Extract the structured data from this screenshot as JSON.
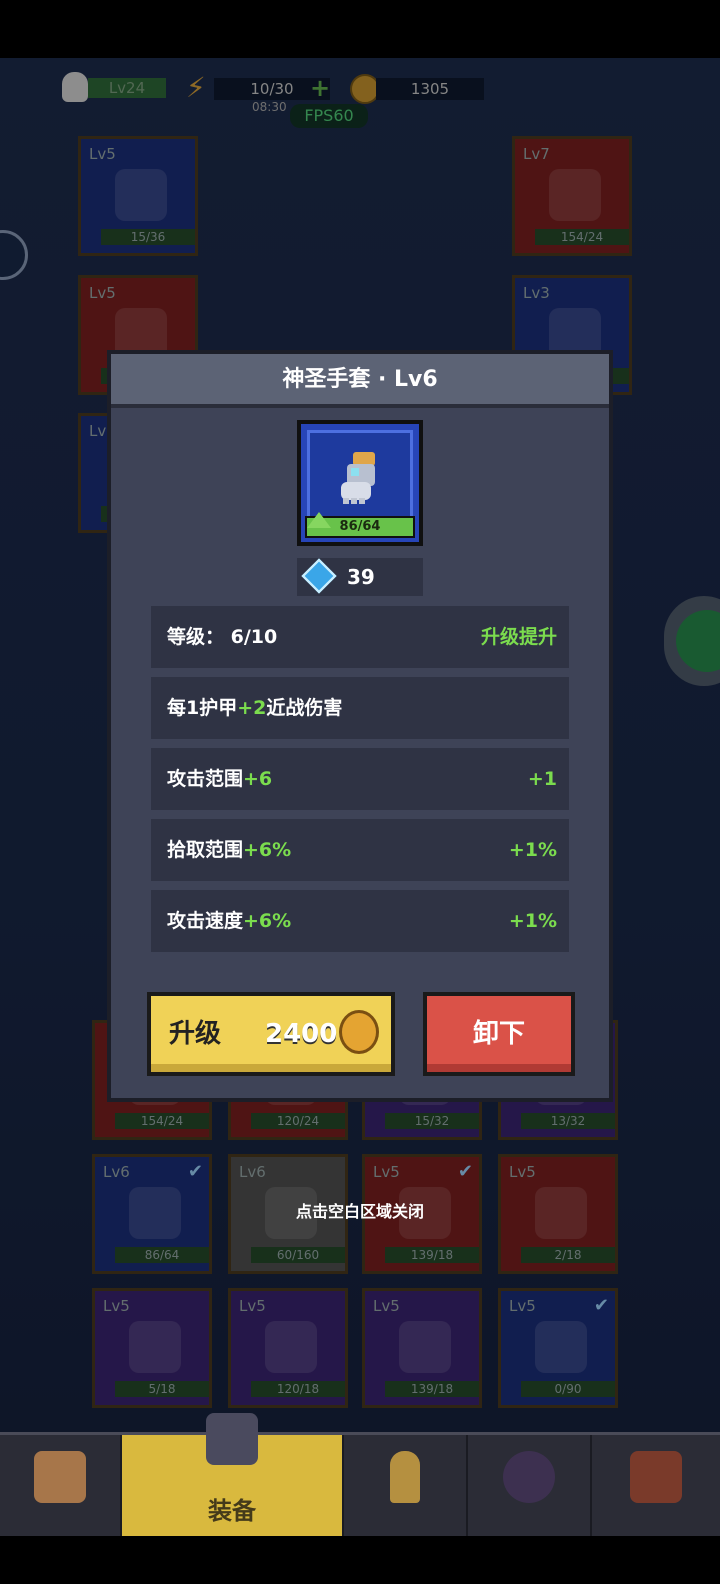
{
  "hud": {
    "player_level": "Lv24",
    "energy": "10/30",
    "energy_timer": "08:30",
    "gold": "1305",
    "fps": "FPS60"
  },
  "background_cards": [
    {
      "lv": "Lv5",
      "bar": "15/36",
      "color": "blue"
    },
    {
      "lv": "Lv7",
      "bar": "154/24",
      "color": "red"
    },
    {
      "lv": "Lv5",
      "bar": "",
      "color": "red"
    },
    {
      "lv": "Lv3",
      "bar": "",
      "color": "blue"
    },
    {
      "lv": "Lv",
      "bar": "",
      "color": "blue"
    },
    {
      "lv": "",
      "bar": "154/24",
      "color": "red"
    },
    {
      "lv": "",
      "bar": "120/24",
      "color": "red"
    },
    {
      "lv": "",
      "bar": "15/32",
      "color": "purple"
    },
    {
      "lv": "",
      "bar": "13/32",
      "color": "purple"
    },
    {
      "lv": "Lv6",
      "bar": "86/64",
      "color": "blue"
    },
    {
      "lv": "Lv6",
      "bar": "60/160",
      "color": "grey"
    },
    {
      "lv": "Lv5",
      "bar": "139/18",
      "color": "red"
    },
    {
      "lv": "Lv5",
      "bar": "2/18",
      "color": "red"
    },
    {
      "lv": "Lv5",
      "bar": "5/18",
      "color": "purple"
    },
    {
      "lv": "Lv5",
      "bar": "120/18",
      "color": "purple"
    },
    {
      "lv": "Lv5",
      "bar": "139/18",
      "color": "purple"
    },
    {
      "lv": "Lv5",
      "bar": "0/90",
      "color": "blue"
    }
  ],
  "close_hint": "点击空白区域关闭",
  "modal": {
    "title": "神圣手套 · Lv6",
    "item_progress": "86/64",
    "gem_count": "39",
    "level_label": "等级：",
    "level_value": "6/10",
    "level_action": "升级提升",
    "effect_prefix": "每1护甲",
    "effect_value": "+2",
    "effect_suffix": "近战伤害",
    "stats": [
      {
        "name": "攻击范围",
        "value": "+6",
        "bonus": "+1"
      },
      {
        "name": "拾取范围",
        "value": "+6%",
        "bonus": "+1%"
      },
      {
        "name": "攻击速度",
        "value": "+6%",
        "bonus": "+1%"
      }
    ],
    "upgrade_label": "升级",
    "upgrade_cost": "2400",
    "unequip_label": "卸下"
  },
  "tabs": [
    {
      "name": "box",
      "label": ""
    },
    {
      "name": "equipment",
      "label": "装备"
    },
    {
      "name": "bullet",
      "label": ""
    },
    {
      "name": "pentagram",
      "label": ""
    },
    {
      "name": "book",
      "label": ""
    }
  ],
  "colors": {
    "accent_yellow": "#f0d257",
    "danger_red": "#da5248",
    "stat_green": "#7bdc4e",
    "modal_bg": "#3e4357"
  }
}
